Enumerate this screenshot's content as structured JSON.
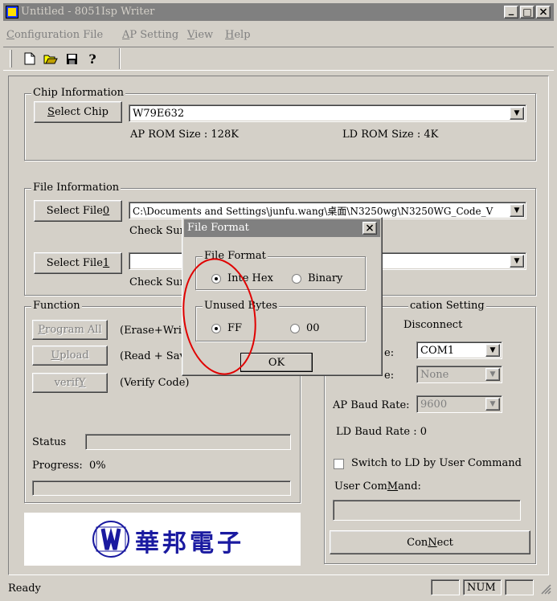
{
  "window": {
    "title": "Untitled - 8051Isp Writer",
    "min": "_",
    "max": "□",
    "close": "×"
  },
  "menu": [
    {
      "pre": "",
      "u": "C",
      "post": "onfiguration File"
    },
    {
      "pre": "",
      "u": "A",
      "post": "P Setting"
    },
    {
      "pre": "",
      "u": "V",
      "post": "iew"
    },
    {
      "pre": "",
      "u": "H",
      "post": "elp"
    }
  ],
  "toolbar": {
    "help": "?"
  },
  "chip": {
    "group": "Chip Information",
    "select_pre": "",
    "select_u": "S",
    "select_post": "elect Chip",
    "value": "W79E632",
    "ap_rom": "AP ROM Size : 128K",
    "ld_rom": "LD ROM Size : 4K"
  },
  "file": {
    "group": "File Information",
    "sel0_pre": "Select File",
    "sel0_u": "0",
    "path0": "C:\\Documents and Settings\\junfu.wang\\桌面\\N3250wg\\N3250WG_Code_V",
    "checksum0": "Check Sum",
    "sel1_pre": "Select File",
    "sel1_u": "1",
    "path1": "",
    "checksum1": "Check Sum"
  },
  "function": {
    "group": "Function",
    "program_all": {
      "u": "P",
      "post": "rogram All"
    },
    "program_desc": "(Erase+Write",
    "upload": {
      "u": "U",
      "post": "pload"
    },
    "upload_desc": "(Read + Save",
    "verify": {
      "pre": "verif",
      "u": "Y"
    },
    "verify_desc": "(Verify Code)",
    "status_label": "Status",
    "progress_label": "Progress:",
    "progress_value": "0%"
  },
  "logo_text": "華邦電子",
  "comm": {
    "group": "cation Setting",
    "status": "Disconnect",
    "port_label": "e:",
    "port_value": "COM1",
    "mode_label": "e:",
    "mode_value": "None",
    "ap_baud_label": "AP Baud Rate:",
    "ap_baud_value": "9600",
    "ld_baud": "LD Baud Rate : 0",
    "switch_label": "Switch to LD by User Command",
    "user_cmd_pre": "User Com",
    "user_cmd_u": "M",
    "user_cmd_post": "and:",
    "user_cmd_value": "",
    "connect_pre": "Con",
    "connect_u": "N",
    "connect_post": "ect"
  },
  "dialog": {
    "title": "File Format",
    "close": "×",
    "format_group": "File Format",
    "intel_hex": "Inte Hex",
    "binary": "Binary",
    "unused_group": "Unused Bytes",
    "ff": "FF",
    "zero": "00",
    "ok": "OK"
  },
  "statusbar": {
    "text": "Ready",
    "num": "NUM"
  },
  "colors": {
    "titlebar": "#808080",
    "annotation": "#e00000",
    "logo": "#1a1aa0"
  }
}
